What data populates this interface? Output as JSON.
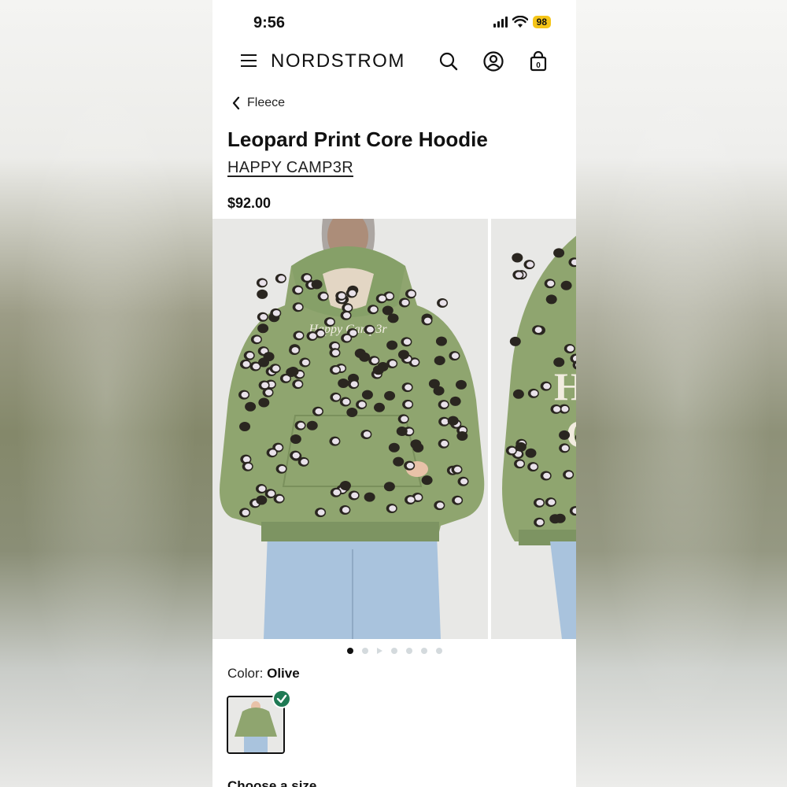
{
  "status_bar": {
    "time": "9:56",
    "battery": "98"
  },
  "header": {
    "logo": "NORDSTROM"
  },
  "breadcrumb": {
    "label": "Fleece"
  },
  "product": {
    "title": "Leopard Print Core Hoodie",
    "brand": "HAPPY CAMP3R",
    "price": "$92.00",
    "color_label": "Color:",
    "color_value": "Olive",
    "size_prompt": "Choose a size"
  },
  "carousel": {
    "total_images": 7,
    "active_index": 0
  },
  "colors": {
    "hoodie": "#8fa56f",
    "spot_dark": "#2a2620",
    "spot_light": "#e9e2ea",
    "jeans": "#a9c3dd",
    "check": "#1f7a54"
  },
  "icons": [
    "menu-icon",
    "search-icon",
    "account-icon",
    "bag-icon",
    "chevron-left-icon",
    "check-icon"
  ]
}
